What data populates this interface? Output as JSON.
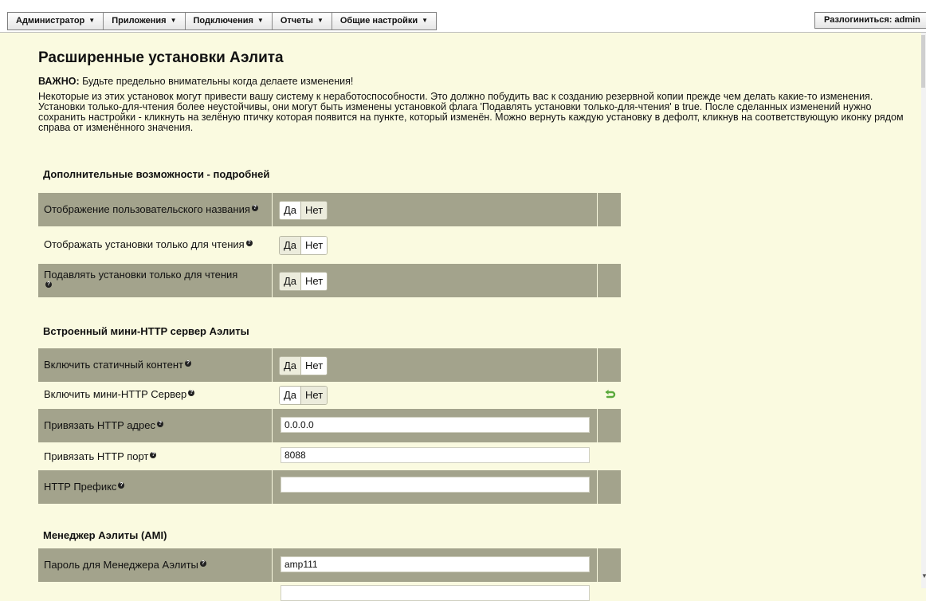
{
  "menu": [
    {
      "label": "Администратор"
    },
    {
      "label": "Приложения"
    },
    {
      "label": "Подключения"
    },
    {
      "label": "Отчеты"
    },
    {
      "label": "Общие настройки"
    }
  ],
  "logout_label": "Разлогиниться: admin",
  "page_title": "Расширенные установки Аэлита",
  "warning": {
    "bold": "ВАЖНО:",
    "text": " Будьте предельно внимательны когда делаете изменения!"
  },
  "intro": "Некоторые из этих установок могут привести вашу систему к неработоспособности. Это должно побудить вас к созданию резервной копии прежде чем делать какие-то изменения. Установки только-для-чтения более неустойчивы, они могут быть изменены установкой флага 'Подавлять установки только-для-чтения' в true. После сделанных изменений нужно сохранить настройки - кликнуть на зелёную птичку которая появится на пункте, который изменён. Можно вернуть каждую установку в дефолт, кликнув на соответствующую иконку рядом справа от изменённого значения.",
  "toggle_yes": "Да",
  "toggle_no": "Нет",
  "help_icon": "question-circle-icon",
  "undo_icon_color": "#5aaa3c",
  "sections": [
    {
      "title": "Дополнительные возможности - подробней",
      "rows": [
        {
          "label": "Отображение пользовательского названия",
          "type": "toggle",
          "value": "Да"
        },
        {
          "label": "Отображать установки только для чтения",
          "type": "toggle",
          "value": "Да"
        },
        {
          "label": "Подавлять установки только для чтения",
          "type": "toggle",
          "value": "Да"
        }
      ]
    },
    {
      "title": "Встроенный мини-HTTP сервер Аэлиты",
      "rows": [
        {
          "label": "Включить статичный контент",
          "type": "toggle",
          "value": "Нет"
        },
        {
          "label": "Включить мини-HTTP Сервер",
          "type": "toggle",
          "value": "Да",
          "changed": true
        },
        {
          "label": "Привязать HTTP адрес",
          "type": "text",
          "value": "0.0.0.0"
        },
        {
          "label": "Привязать HTTP порт",
          "type": "text",
          "value": "8088"
        },
        {
          "label": "HTTP Префикс",
          "type": "text",
          "value": ""
        }
      ]
    },
    {
      "title": "Менеджер Аэлиты (AMI)",
      "rows": [
        {
          "label": "Пароль для Менеджера Аэлиты",
          "type": "text",
          "value": "amp111"
        }
      ]
    }
  ]
}
